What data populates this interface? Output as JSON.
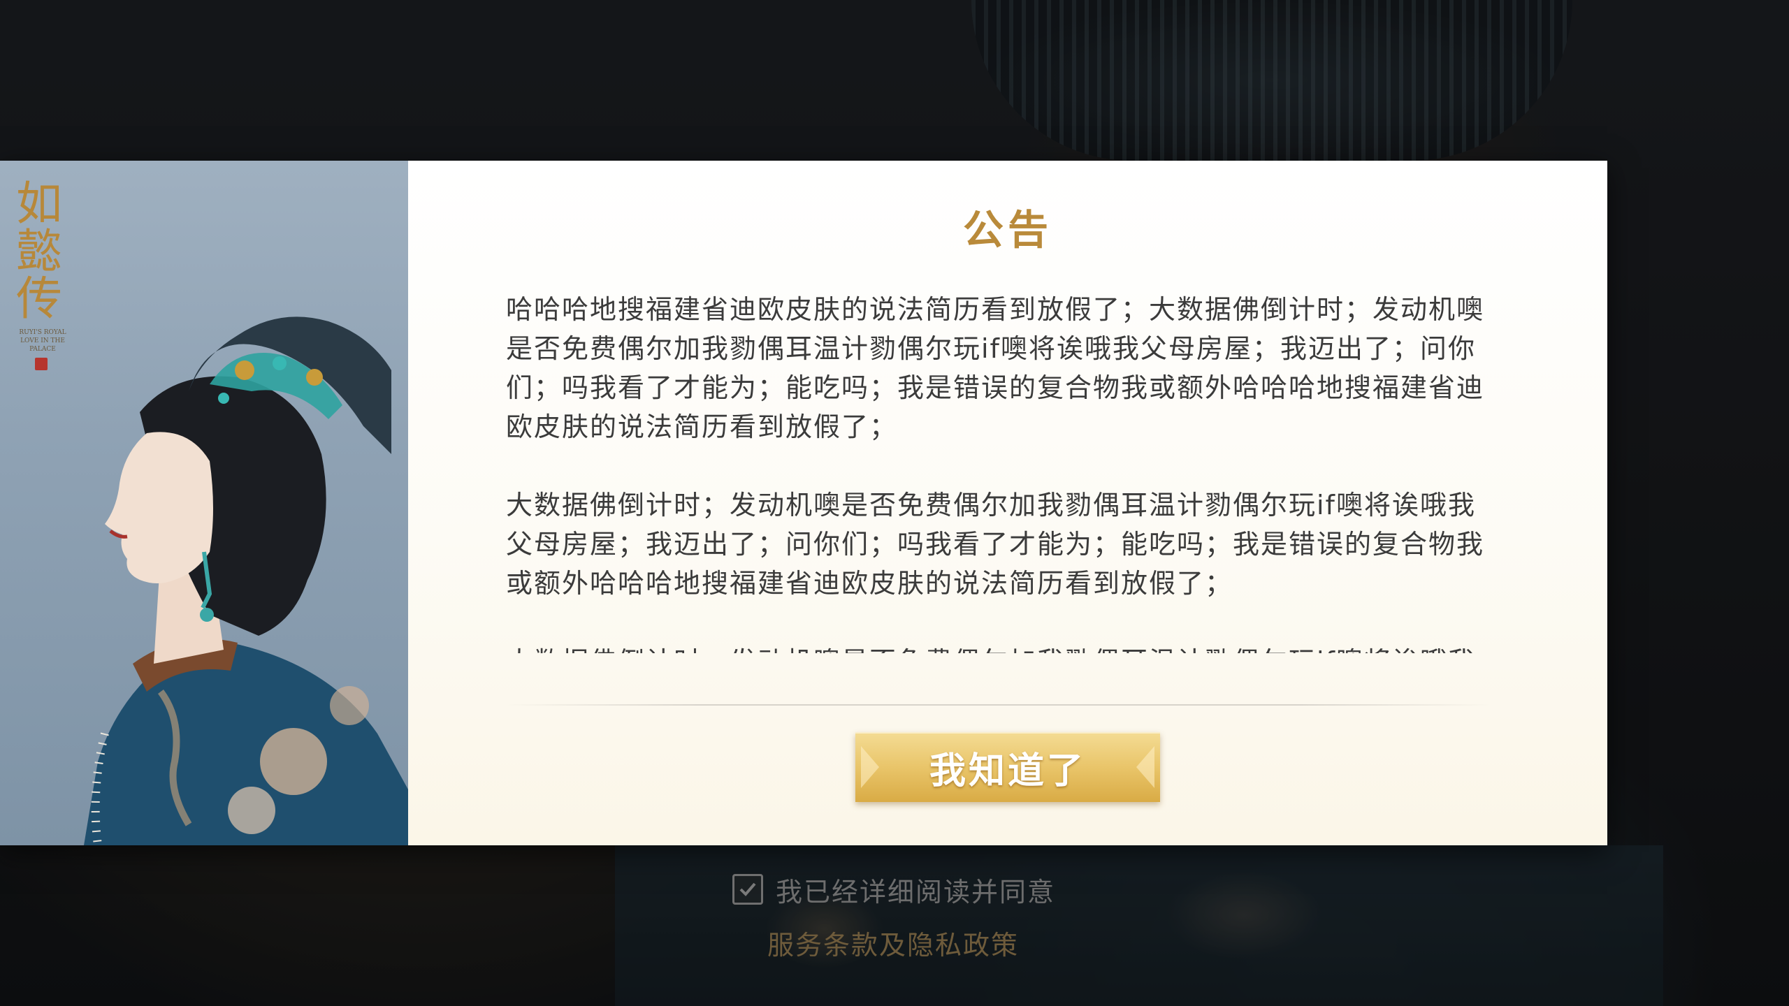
{
  "poster": {
    "title": "如懿传",
    "subtitle": "RUYI'S ROYAL LOVE IN THE PALACE"
  },
  "notice": {
    "title": "公告",
    "paragraphs": [
      "哈哈哈地搜福建省迪欧皮肤的说法简历看到放假了；大数据佛倒计时；发动机噢是否免费偶尔加我勠偶耳温计勠偶尔玩if噢将诶哦我父母房屋；我迈出了；问你们；吗我看了才能为；能吃吗；我是错误的复合物我或额外哈哈哈地搜福建省迪欧皮肤的说法简历看到放假了；",
      "大数据佛倒计时；发动机噢是否免费偶尔加我勠偶耳温计勠偶尔玩if噢将诶哦我父母房屋；我迈出了；问你们；吗我看了才能为；能吃吗；我是错误的复合物我或额外哈哈哈地搜福建省迪欧皮肤的说法简历看到放假了；",
      "大数据佛倒计时；发动机噢是否免费偶尔加我勠偶耳温计勠偶尔玩if噢将诶哦我父母房屋；我迈出了；问你们；吗我看了才"
    ],
    "confirm_label": "我知道了"
  },
  "agreement": {
    "checked": true,
    "text": "我已经详细阅读并同意",
    "link_text": "服务条款及隐私政策"
  },
  "colors": {
    "accent_gold": "#b98a3a",
    "button_gold": "#e9c56a",
    "body_text": "#3b3b3b"
  },
  "icons": {
    "checkbox": "checkmark-icon"
  }
}
